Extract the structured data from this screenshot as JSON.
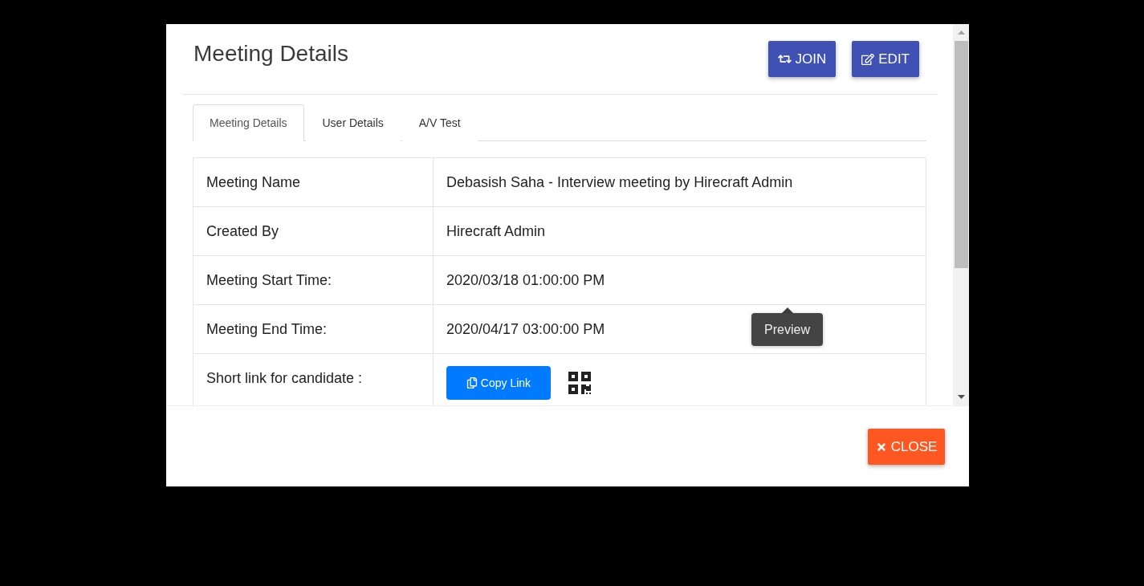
{
  "dialog": {
    "title": "Meeting Details",
    "header_buttons": [
      {
        "kind": "join",
        "label": "JOIN"
      },
      {
        "kind": "edit",
        "label": "EDIT"
      }
    ]
  },
  "tabs": [
    {
      "label": "Meeting Details",
      "selected": true
    },
    {
      "label": "User Details",
      "selected": false
    },
    {
      "label": "A/V Test",
      "selected": false
    }
  ],
  "details": [
    {
      "kind": "text",
      "label": "Meeting Name",
      "value": "Debasish Saha - Interview meeting by Hirecraft Admin"
    },
    {
      "kind": "text",
      "label": "Created By",
      "value": "Hirecraft Admin"
    },
    {
      "kind": "text",
      "label": "Meeting Start Time:",
      "value": "2020/03/18 01:00:00 PM"
    },
    {
      "kind": "text",
      "label": "Meeting End Time:",
      "value": "2020/04/17 03:00:00 PM"
    },
    {
      "kind": "link",
      "label": "Short link for candidate :",
      "button": "Copy Link"
    }
  ],
  "tooltip": {
    "text": "Preview"
  },
  "footer": {
    "close_button": "CLOSE"
  }
}
